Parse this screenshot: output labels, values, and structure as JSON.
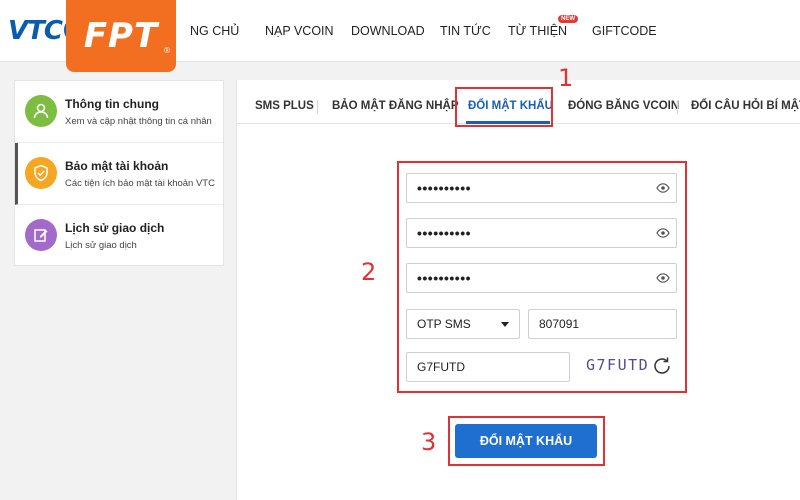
{
  "header": {
    "vtc_logo": "VTC",
    "fpt_logo": "FPT",
    "fpt_reg": "®",
    "nav": [
      {
        "label": "NG CHỦ"
      },
      {
        "label": "NẠP VCOIN"
      },
      {
        "label": "DOWNLOAD"
      },
      {
        "label": "TIN TỨC"
      },
      {
        "label": "TỪ THIỆN"
      },
      {
        "label": "GIFTCODE"
      }
    ],
    "new_badge": "NEW"
  },
  "sidebar": {
    "items": [
      {
        "title": "Thông tin chung",
        "subtitle": "Xem và cập nhật thông tin cá nhân",
        "icon": "user-icon",
        "color": "#7cbd42"
      },
      {
        "title": "Bảo mật tài khoản",
        "subtitle": "Các tiện ích bảo mật tài khoản VTC",
        "icon": "shield-icon",
        "color": "#f5a623"
      },
      {
        "title": "Lịch sử giao dịch",
        "subtitle": "Lịch sử giao dịch",
        "icon": "edit-icon",
        "color": "#a36bc9"
      }
    ]
  },
  "tabs": [
    {
      "label": "SMS PLUS"
    },
    {
      "label": "BẢO MẬT ĐĂNG NHẬP"
    },
    {
      "label": "ĐỔI MẬT KHẨU"
    },
    {
      "label": "ĐÓNG BĂNG VCOIN"
    },
    {
      "label": "ĐỔI CÂU HỎI BÍ MẬT"
    }
  ],
  "form": {
    "password_1": "••••••••••",
    "password_2": "••••••••••",
    "password_3": "••••••••••",
    "otp_method": "OTP SMS",
    "otp_code": "807091",
    "captcha_input": "G7FUTD",
    "captcha_image": "G7FUTD",
    "submit_label": "ĐỔI MẬT KHẨU"
  },
  "annotations": {
    "step_1": "1",
    "step_2": "2",
    "step_3": "3"
  },
  "colors": {
    "accent": "#1e6fd0",
    "annotation": "#e03232",
    "fpt_orange": "#f26f21",
    "vtc_blue": "#0b5cad"
  }
}
